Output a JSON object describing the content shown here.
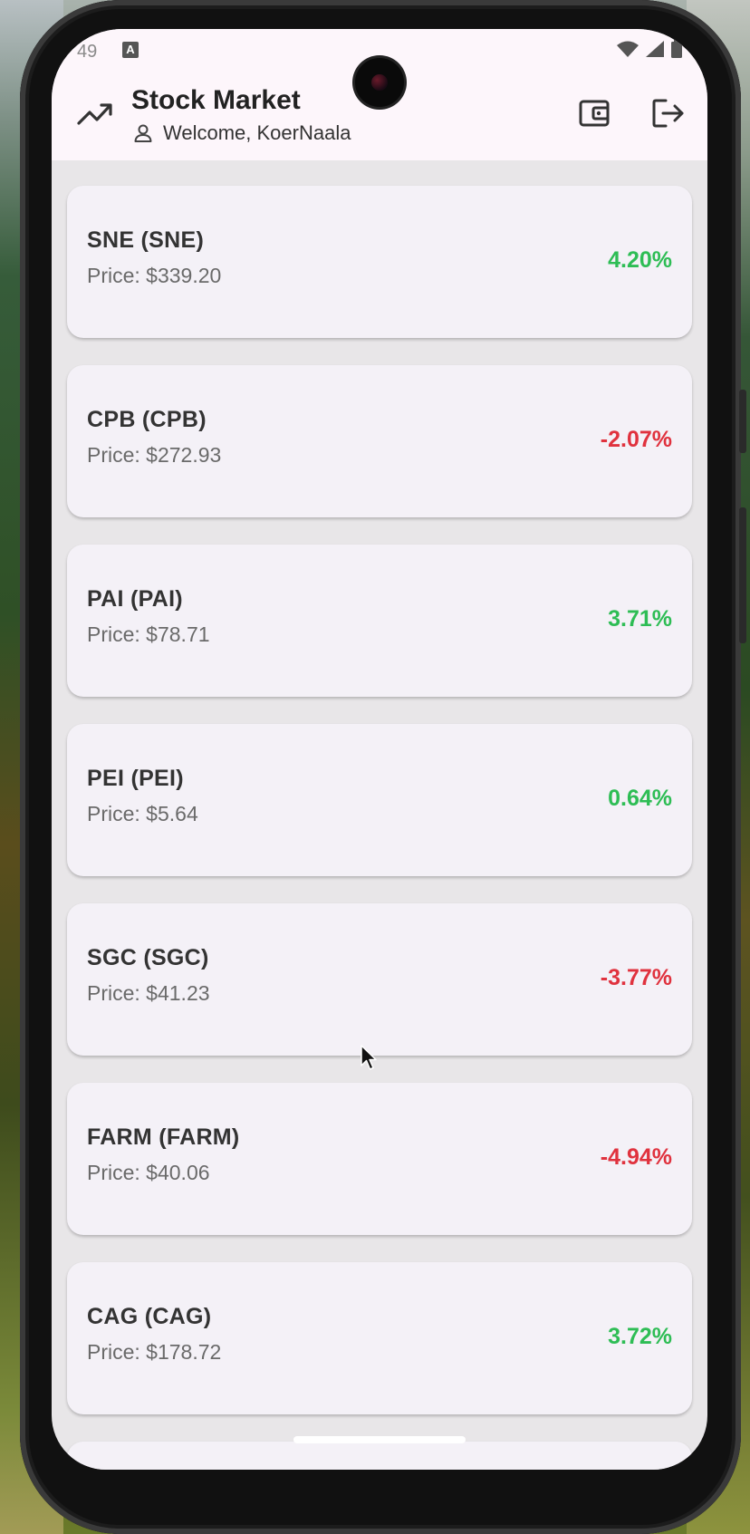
{
  "status_bar": {
    "time": "49",
    "indicator": "A"
  },
  "appbar": {
    "title": "Stock Market",
    "welcome": "Welcome, KoerNaala",
    "icons": [
      "trending-up-icon",
      "person-icon",
      "wallet-icon",
      "logout-icon"
    ]
  },
  "stocks": [
    {
      "name": "SNE (SNE)",
      "price": "Price: $339.20",
      "change": "4.20%",
      "direction": "up"
    },
    {
      "name": "CPB (CPB)",
      "price": "Price: $272.93",
      "change": "-2.07%",
      "direction": "down"
    },
    {
      "name": "PAI (PAI)",
      "price": "Price: $78.71",
      "change": "3.71%",
      "direction": "up"
    },
    {
      "name": "PEI (PEI)",
      "price": "Price: $5.64",
      "change": "0.64%",
      "direction": "up"
    },
    {
      "name": "SGC (SGC)",
      "price": "Price: $41.23",
      "change": "-3.77%",
      "direction": "down"
    },
    {
      "name": "FARM (FARM)",
      "price": "Price: $40.06",
      "change": "-4.94%",
      "direction": "down"
    },
    {
      "name": "CAG (CAG)",
      "price": "Price: $178.72",
      "change": "3.72%",
      "direction": "up"
    }
  ],
  "colors": {
    "up": "#2ebd55",
    "down": "#e0323e",
    "appbar_bg": "#fdf6fb",
    "card_bg": "#f4f1f7"
  }
}
